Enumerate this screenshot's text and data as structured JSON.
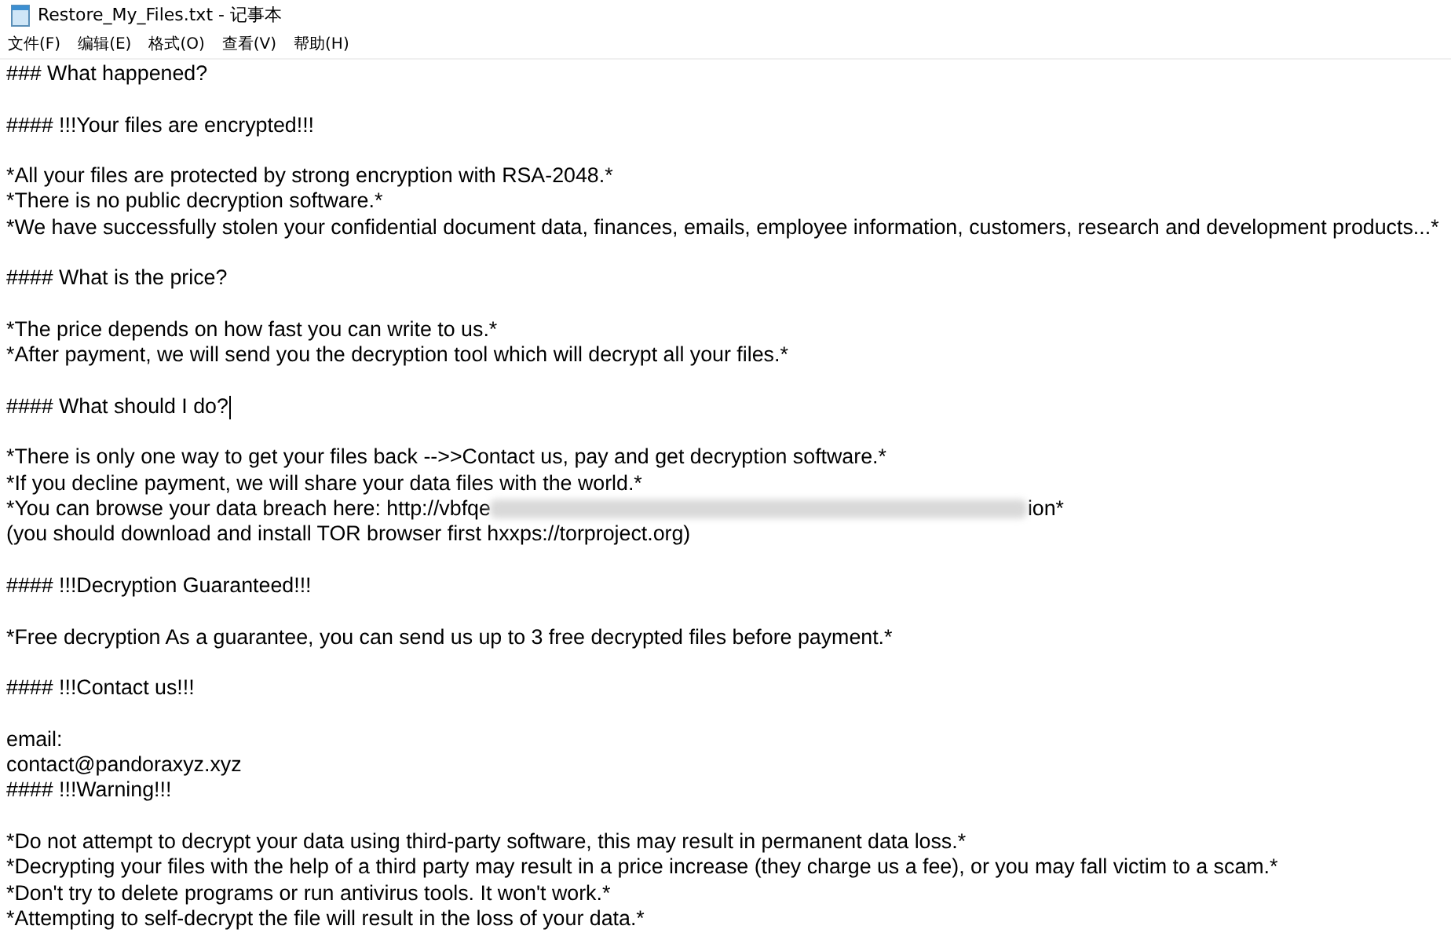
{
  "window": {
    "title": "Restore_My_Files.txt - 记事本"
  },
  "menu": [
    "文件(F)",
    "编辑(E)",
    "格式(O)",
    "查看(V)",
    "帮助(H)"
  ],
  "lines": [
    {
      "kind": "text",
      "text": "### What happened?"
    },
    {
      "kind": "blank"
    },
    {
      "kind": "text",
      "text": "#### !!!Your files are encrypted!!!"
    },
    {
      "kind": "blank"
    },
    {
      "kind": "text",
      "text": "*All your files are protected by strong encryption with RSA-2048.*"
    },
    {
      "kind": "text",
      "text": "*There is no public decryption software.*"
    },
    {
      "kind": "text",
      "text": "*We have successfully stolen your confidential document data, finances, emails, employee information, customers, research and development products...*"
    },
    {
      "kind": "blank"
    },
    {
      "kind": "text",
      "text": "#### What is the price?"
    },
    {
      "kind": "blank"
    },
    {
      "kind": "text",
      "text": "*The price depends on how fast you can write to us.*"
    },
    {
      "kind": "text",
      "text": "*After payment, we will send you the decryption tool which will decrypt all your files.*"
    },
    {
      "kind": "blank"
    },
    {
      "kind": "text",
      "text": "#### What should I do?",
      "caret": true
    },
    {
      "kind": "blank"
    },
    {
      "kind": "text",
      "text": "*There is only one way to get your files back -->>Contact us, pay and get decryption software.*"
    },
    {
      "kind": "text",
      "text": "*If you decline payment, we will share your data files with the world.*"
    },
    {
      "kind": "redacted",
      "before": "*You can browse your data breach here: http://vbfqe",
      "after": "ion*"
    },
    {
      "kind": "text",
      "text": "(you should download and install TOR browser first hxxps://torproject.org)"
    },
    {
      "kind": "blank"
    },
    {
      "kind": "text",
      "text": "#### !!!Decryption Guaranteed!!!"
    },
    {
      "kind": "blank"
    },
    {
      "kind": "text",
      "text": "*Free decryption As a guarantee, you can send us up to 3 free decrypted files before payment.*"
    },
    {
      "kind": "blank"
    },
    {
      "kind": "text",
      "text": "#### !!!Contact us!!!"
    },
    {
      "kind": "blank"
    },
    {
      "kind": "text",
      "text": "email:"
    },
    {
      "kind": "text",
      "text": "contact@pandoraxyz.xyz"
    },
    {
      "kind": "text",
      "text": "#### !!!Warning!!!"
    },
    {
      "kind": "blank"
    },
    {
      "kind": "text",
      "text": "*Do not attempt to decrypt your data using third-party software, this may result in permanent data loss.*"
    },
    {
      "kind": "text",
      "text": "*Decrypting your files with the help of a third party may result in a price increase (they charge us a fee), or you may fall victim to a scam.*"
    },
    {
      "kind": "text",
      "text": "*Don't try to delete programs or run antivirus tools. It won't work.*"
    },
    {
      "kind": "text",
      "text": "*Attempting to self-decrypt the file will result in the loss of your data.*"
    }
  ]
}
